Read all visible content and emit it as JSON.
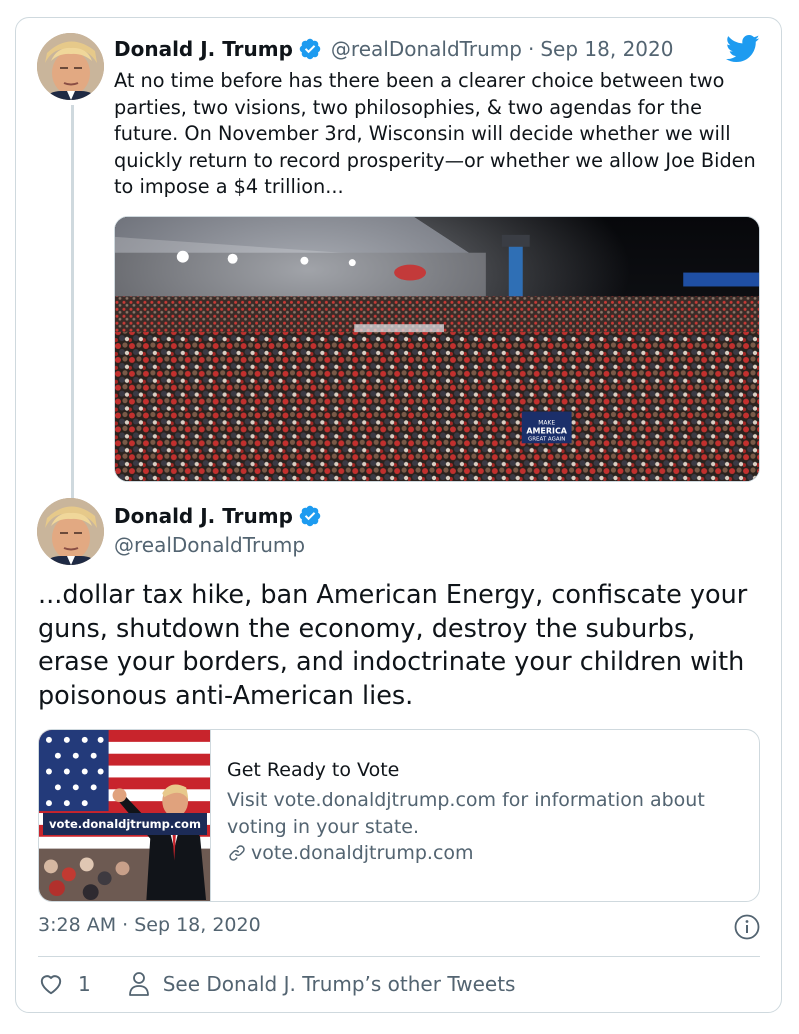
{
  "tweet1": {
    "name": "Donald J. Trump",
    "handle": "@realDonaldTrump",
    "separator": "·",
    "date": "Sep 18, 2020",
    "text": "At no time before has there been a clearer choice between two parties, two visions, two philosophies, & two agendas for the future. On November 3rd, Wisconsin will decide whether we will quickly return to record prosperity—or whether we allow Joe Biden to impose a $4 trillion...",
    "photo_signs": [
      "MAKE AMERICA GREAT AGAIN",
      "MAKE AMERICA GREAT AGAIN"
    ]
  },
  "tweet2": {
    "name": "Donald J. Trump",
    "handle": "@realDonaldTrump",
    "text": "...dollar tax hike, ban American Energy, confiscate your guns, shutdown the economy, destroy the suburbs, erase your borders, and indoctrinate your children with poisonous anti-American lies."
  },
  "link_card": {
    "thumb_label": "vote.donaldjtrump.com",
    "title": "Get Ready to Vote",
    "description": "Visit vote.donaldjtrump.com for information about voting in your state.",
    "url": "vote.donaldjtrump.com"
  },
  "footer": {
    "timestamp": "3:28 AM · Sep 18, 2020",
    "like_count": "1",
    "other_tweets": "See Donald J. Trump’s other Tweets"
  },
  "colors": {
    "verified": "#1d9bf0",
    "twitter_blue": "#1d9bf0",
    "secondary_text": "#536471",
    "border": "#cfd9de"
  },
  "icons": [
    "twitter-bird-icon",
    "verified-badge-icon",
    "link-icon",
    "info-icon",
    "heart-icon",
    "person-icon"
  ]
}
